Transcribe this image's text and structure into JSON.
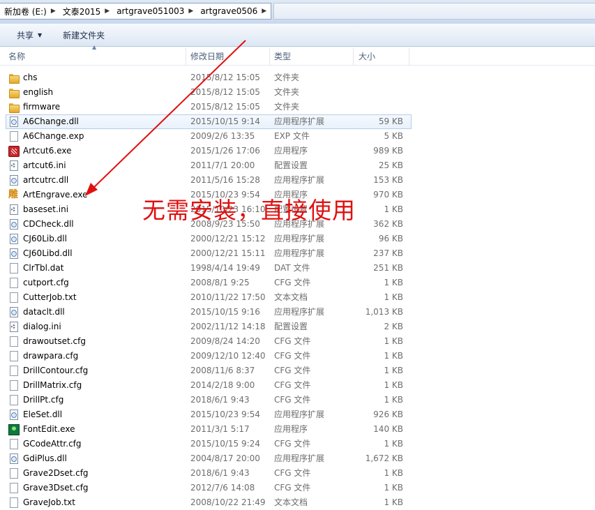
{
  "address": {
    "crumbs": [
      "新加卷 (E:)",
      "文泰2015",
      "artgrave051003",
      "artgrave0506"
    ]
  },
  "toolbar": {
    "share_label": "共享",
    "new_folder_label": "新建文件夹"
  },
  "columns": {
    "name": "名称",
    "date": "修改日期",
    "type": "类型",
    "size": "大小"
  },
  "files": [
    {
      "name": "chs",
      "date": "2015/8/12 15:05",
      "type": "文件夹",
      "size": "",
      "icon": "folder-icon"
    },
    {
      "name": "english",
      "date": "2015/8/12 15:05",
      "type": "文件夹",
      "size": "",
      "icon": "folder-icon"
    },
    {
      "name": "firmware",
      "date": "2015/8/12 15:05",
      "type": "文件夹",
      "size": "",
      "icon": "folder-icon"
    },
    {
      "name": "A6Change.dll",
      "date": "2015/10/15 9:14",
      "type": "应用程序扩展",
      "size": "59 KB",
      "icon": "dll-icon"
    },
    {
      "name": "A6Change.exp",
      "date": "2009/2/6 13:35",
      "type": "EXP 文件",
      "size": "5 KB",
      "icon": "file-icon"
    },
    {
      "name": "Artcut6.exe",
      "date": "2015/1/26 17:06",
      "type": "应用程序",
      "size": "989 KB",
      "icon": "artcut-icon"
    },
    {
      "name": "artcut6.ini",
      "date": "2011/7/1 20:00",
      "type": "配置设置",
      "size": "25 KB",
      "icon": "ini-icon"
    },
    {
      "name": "artcutrc.dll",
      "date": "2011/5/16 15:28",
      "type": "应用程序扩展",
      "size": "153 KB",
      "icon": "dll-icon"
    },
    {
      "name": "ArtEngrave.exe",
      "date": "2015/10/23 9:54",
      "type": "应用程序",
      "size": "970 KB",
      "icon": "artengrave-icon"
    },
    {
      "name": "baseset.ini",
      "date": "2015/10/23 16:10",
      "type": "配置设置",
      "size": "1 KB",
      "icon": "ini-icon"
    },
    {
      "name": "CDCheck.dll",
      "date": "2008/9/23 15:50",
      "type": "应用程序扩展",
      "size": "362 KB",
      "icon": "dll-icon"
    },
    {
      "name": "CJ60Lib.dll",
      "date": "2000/12/21 15:12",
      "type": "应用程序扩展",
      "size": "96 KB",
      "icon": "dll-icon"
    },
    {
      "name": "CJ60Libd.dll",
      "date": "2000/12/21 15:11",
      "type": "应用程序扩展",
      "size": "237 KB",
      "icon": "dll-icon"
    },
    {
      "name": "ClrTbl.dat",
      "date": "1998/4/14 19:49",
      "type": "DAT 文件",
      "size": "251 KB",
      "icon": "file-icon"
    },
    {
      "name": "cutport.cfg",
      "date": "2008/8/1 9:25",
      "type": "CFG 文件",
      "size": "1 KB",
      "icon": "file-icon"
    },
    {
      "name": "CutterJob.txt",
      "date": "2010/11/22 17:50",
      "type": "文本文档",
      "size": "1 KB",
      "icon": "file-icon"
    },
    {
      "name": "dataclt.dll",
      "date": "2015/10/15 9:16",
      "type": "应用程序扩展",
      "size": "1,013 KB",
      "icon": "dll-icon"
    },
    {
      "name": "dialog.ini",
      "date": "2002/11/12 14:18",
      "type": "配置设置",
      "size": "2 KB",
      "icon": "ini-icon"
    },
    {
      "name": "drawoutset.cfg",
      "date": "2009/8/24 14:20",
      "type": "CFG 文件",
      "size": "1 KB",
      "icon": "file-icon"
    },
    {
      "name": "drawpara.cfg",
      "date": "2009/12/10 12:40",
      "type": "CFG 文件",
      "size": "1 KB",
      "icon": "file-icon"
    },
    {
      "name": "DrillContour.cfg",
      "date": "2008/11/6 8:37",
      "type": "CFG 文件",
      "size": "1 KB",
      "icon": "file-icon"
    },
    {
      "name": "DrillMatrix.cfg",
      "date": "2014/2/18 9:00",
      "type": "CFG 文件",
      "size": "1 KB",
      "icon": "file-icon"
    },
    {
      "name": "DrillPt.cfg",
      "date": "2018/6/1 9:43",
      "type": "CFG 文件",
      "size": "1 KB",
      "icon": "file-icon"
    },
    {
      "name": "EleSet.dll",
      "date": "2015/10/23 9:54",
      "type": "应用程序扩展",
      "size": "926 KB",
      "icon": "dll-icon"
    },
    {
      "name": "FontEdit.exe",
      "date": "2011/3/1 5:17",
      "type": "应用程序",
      "size": "140 KB",
      "icon": "fontedit-icon"
    },
    {
      "name": "GCodeAttr.cfg",
      "date": "2015/10/15 9:24",
      "type": "CFG 文件",
      "size": "1 KB",
      "icon": "file-icon"
    },
    {
      "name": "GdiPlus.dll",
      "date": "2004/8/17 20:00",
      "type": "应用程序扩展",
      "size": "1,672 KB",
      "icon": "dll-icon"
    },
    {
      "name": "Grave2Dset.cfg",
      "date": "2018/6/1 9:43",
      "type": "CFG 文件",
      "size": "1 KB",
      "icon": "file-icon"
    },
    {
      "name": "Grave3Dset.cfg",
      "date": "2012/7/6 14:08",
      "type": "CFG 文件",
      "size": "1 KB",
      "icon": "file-icon"
    },
    {
      "name": "GraveJob.txt",
      "date": "2008/10/22 21:49",
      "type": "文本文档",
      "size": "1 KB",
      "icon": "file-icon"
    }
  ],
  "selected_index": 3,
  "annotation": {
    "text": "无需安装，直接使用",
    "color": "#e01010"
  }
}
